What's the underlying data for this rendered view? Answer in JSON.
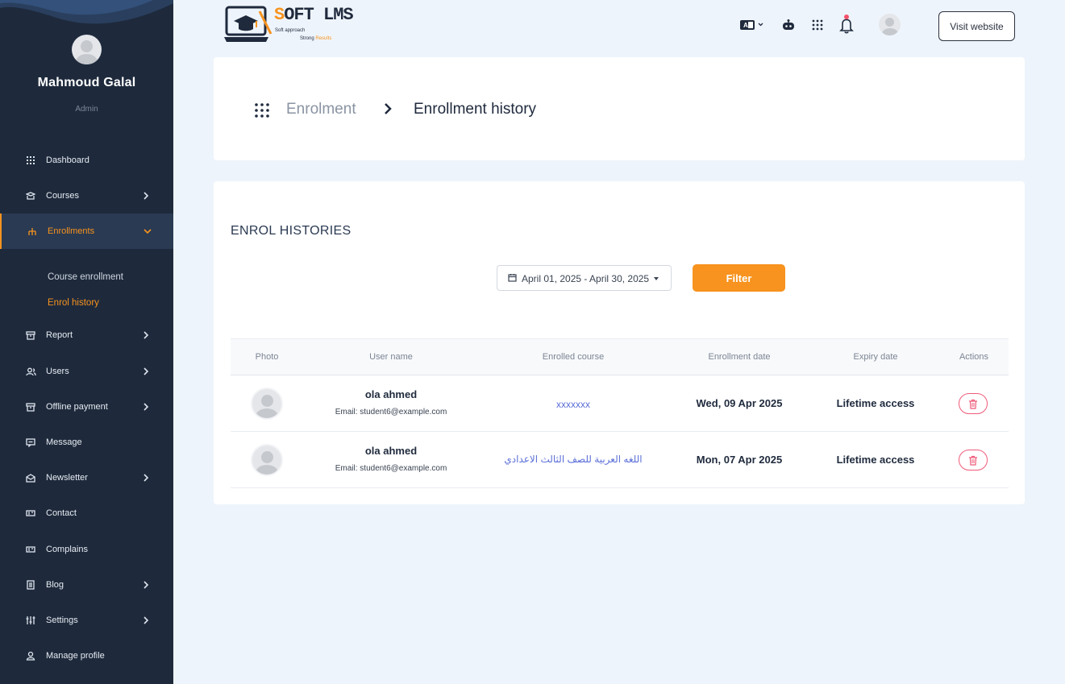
{
  "brand": {
    "title_first_letter": "S",
    "title_rest": "OFT LMS",
    "tagline_1": "Soft approach",
    "tagline_2a": "Strong ",
    "tagline_2b": "Results",
    "accent_color": "#f7931e"
  },
  "profile": {
    "name": "Mahmoud Galal",
    "role": "Admin"
  },
  "sidebar": {
    "items": [
      {
        "label": "Dashboard",
        "icon": "grid-icon"
      },
      {
        "label": "Courses",
        "icon": "courses-icon"
      },
      {
        "label": "Enrollments",
        "icon": "sitemap-icon"
      },
      {
        "label": "Report",
        "icon": "archive-icon"
      },
      {
        "label": "Users",
        "icon": "users-icon"
      },
      {
        "label": "Offline payment",
        "icon": "archive-icon"
      },
      {
        "label": "Message",
        "icon": "message-icon"
      },
      {
        "label": "Newsletter",
        "icon": "envelope-icon"
      },
      {
        "label": "Contact",
        "icon": "contact-card-icon"
      },
      {
        "label": "Complains",
        "icon": "contact-card-icon"
      },
      {
        "label": "Blog",
        "icon": "document-icon"
      },
      {
        "label": "Settings",
        "icon": "sliders-icon"
      },
      {
        "label": "Manage profile",
        "icon": "user-icon"
      }
    ],
    "sub_items": [
      {
        "label": "Course enrollment"
      },
      {
        "label": "Enrol history"
      }
    ]
  },
  "header": {
    "visit_website_label": "Visit website",
    "icons": [
      "language-icon",
      "robot-icon",
      "apps-icon",
      "bell-icon",
      "avatar"
    ]
  },
  "breadcrumb": {
    "parent": "Enrolment",
    "current": "Enrollment history"
  },
  "main": {
    "section_title": "ENROL HISTORIES",
    "date_range": "April 01, 2025 - April 30, 2025",
    "filter_label": "Filter"
  },
  "table": {
    "headers": [
      "Photo",
      "User name",
      "Enrolled course",
      "Enrollment date",
      "Expiry date",
      "Actions"
    ],
    "rows": [
      {
        "name": "ola ahmed",
        "email": "Email: student6@example.com",
        "course": "xxxxxxx",
        "enrollment_date": "Wed, 09 Apr 2025",
        "expiry": "Lifetime access"
      },
      {
        "name": "ola ahmed",
        "email": "Email: student6@example.com",
        "course": "اللغه العربية للصف الثالث الاعدادي",
        "enrollment_date": "Mon, 07 Apr 2025",
        "expiry": "Lifetime access"
      }
    ]
  }
}
